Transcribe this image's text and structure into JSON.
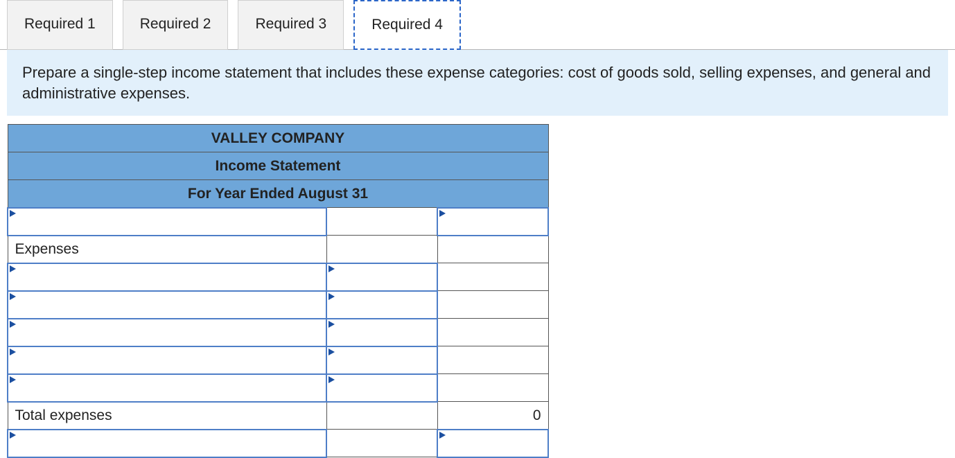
{
  "tabs": [
    {
      "label": "Required 1",
      "active": false
    },
    {
      "label": "Required 2",
      "active": false
    },
    {
      "label": "Required 3",
      "active": false
    },
    {
      "label": "Required 4",
      "active": true
    }
  ],
  "banner": "Prepare a single-step income statement that includes these expense categories: cost of goods sold, selling expenses, and general and administrative expenses.",
  "header": {
    "company": "VALLEY COMPANY",
    "title": "Income Statement",
    "period": "For Year Ended August 31"
  },
  "rows": {
    "expenses_label": "Expenses",
    "total_expenses_label": "Total expenses",
    "total_expenses_value": "0"
  }
}
